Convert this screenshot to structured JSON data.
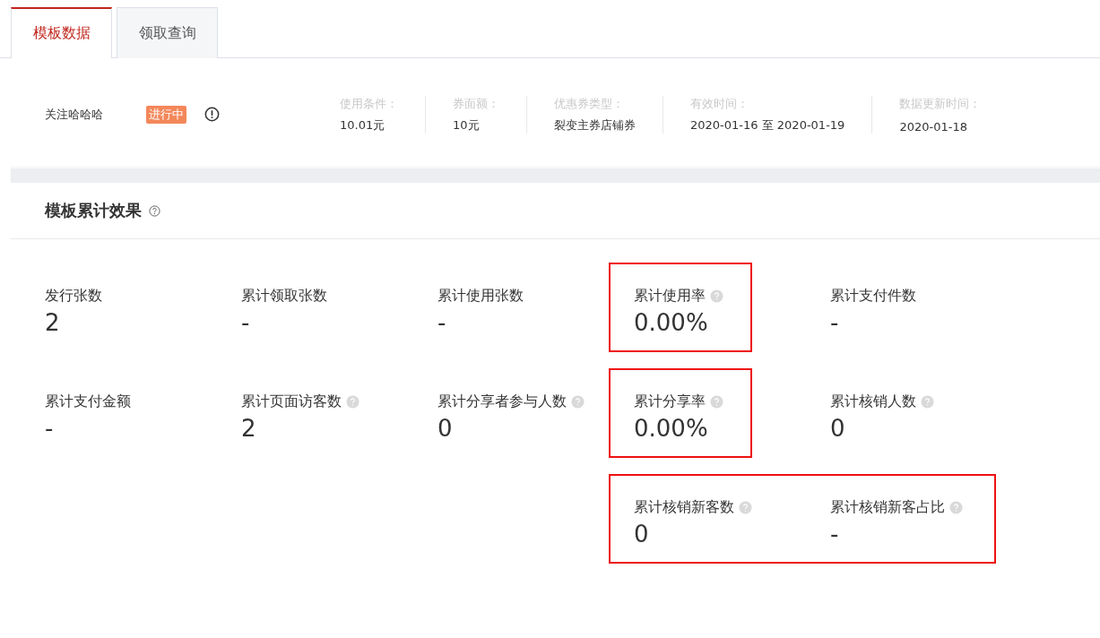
{
  "tabs": [
    {
      "label": "模板数据",
      "selected": true
    },
    {
      "label": "领取查询",
      "selected": false
    }
  ],
  "template": {
    "name": "关注哈哈哈",
    "status": "进行中",
    "fields": [
      {
        "label": "使用条件：",
        "value": "10.01元"
      },
      {
        "label": "券面额：",
        "value": "10元"
      },
      {
        "label": "优惠券类型：",
        "value": "裂变主券店铺券"
      },
      {
        "label": "有效时间：",
        "value": "2020-01-16 至 2020-01-19"
      },
      {
        "label": "数据更新时间：",
        "value": "2020-01-18"
      }
    ]
  },
  "section": {
    "title": "模板累计效果",
    "rows": [
      [
        {
          "label": "发行张数",
          "value": "2",
          "help": false,
          "highlighted": false
        },
        {
          "label": "累计领取张数",
          "value": "-",
          "help": false,
          "highlighted": false
        },
        {
          "label": "累计使用张数",
          "value": "-",
          "help": false,
          "highlighted": false
        },
        {
          "label": "累计使用率",
          "value": "0.00%",
          "help": true,
          "highlighted": true
        },
        {
          "label": "累计支付件数",
          "value": "-",
          "help": false,
          "highlighted": false
        }
      ],
      [
        {
          "label": "累计支付金额",
          "value": "-",
          "help": false,
          "highlighted": false
        },
        {
          "label": "累计页面访客数",
          "value": "2",
          "help": true,
          "highlighted": false
        },
        {
          "label": "累计分享者参与人数",
          "value": "0",
          "help": true,
          "highlighted": false
        },
        {
          "label": "累计分享率",
          "value": "0.00%",
          "help": true,
          "highlighted": true
        },
        {
          "label": "累计核销人数",
          "value": "0",
          "help": true,
          "highlighted": false
        }
      ],
      [
        null,
        null,
        null,
        {
          "label": "累计核销新客数",
          "value": "0",
          "help": true,
          "highlighted": true
        },
        {
          "label": "累计核销新客占比",
          "value": "-",
          "help": true,
          "highlighted": true
        }
      ]
    ]
  }
}
